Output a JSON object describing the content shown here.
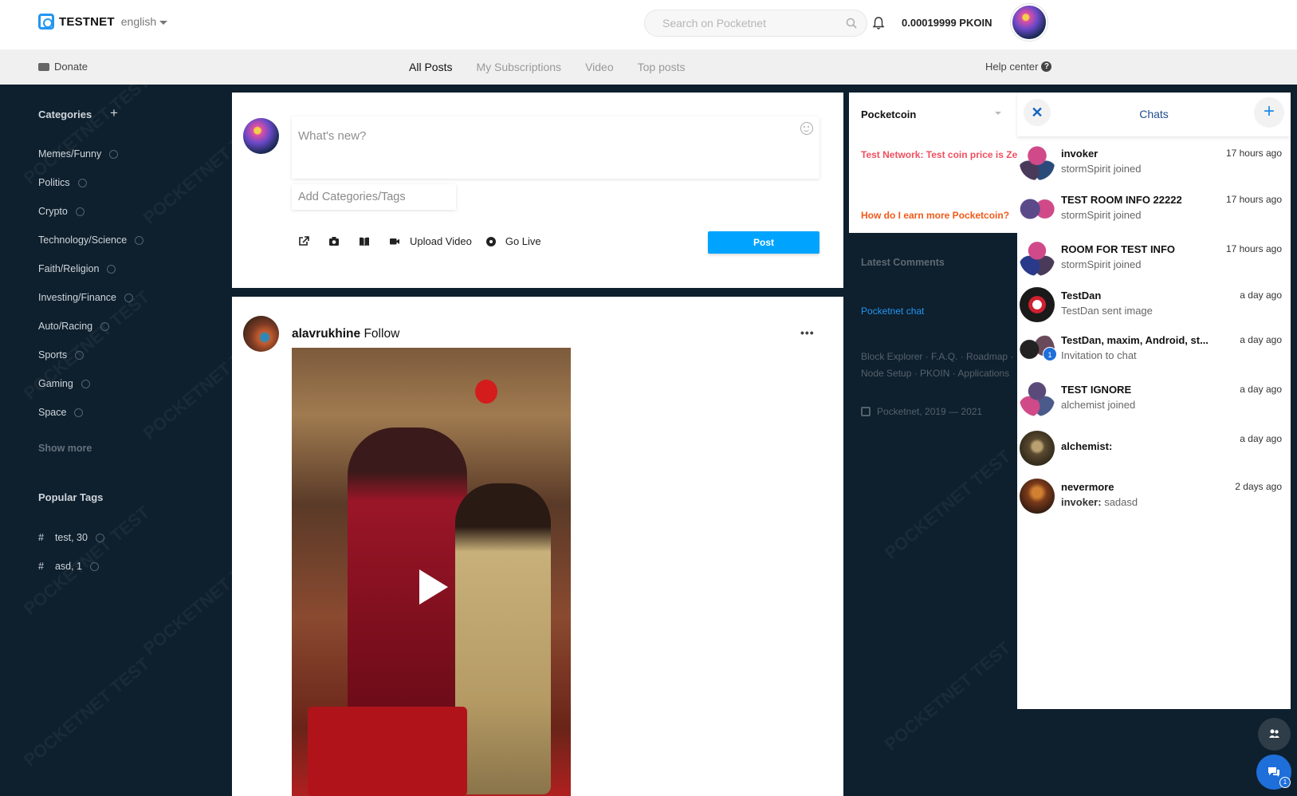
{
  "header": {
    "logo_text": "TESTNET",
    "language": "english",
    "search_placeholder": "Search on Pocketnet",
    "balance": "0.00019999 PKOIN"
  },
  "nav": {
    "donate": "Donate",
    "tabs": [
      {
        "label": "All Posts",
        "active": true
      },
      {
        "label": "My Subscriptions",
        "active": false
      },
      {
        "label": "Video",
        "active": false
      },
      {
        "label": "Top posts",
        "active": false
      }
    ],
    "help": "Help center",
    "help_icon": "?"
  },
  "sidebar": {
    "categories_title": "Categories",
    "add_symbol": "+",
    "categories": [
      "Memes/Funny",
      "Politics",
      "Crypto",
      "Technology/Science",
      "Faith/Religion",
      "Investing/Finance",
      "Auto/Racing",
      "Sports",
      "Gaming",
      "Space"
    ],
    "show_more": "Show more",
    "popular_tags_title": "Popular Tags",
    "tags": [
      {
        "hash": "#",
        "label": "test, 30"
      },
      {
        "hash": "#",
        "label": "asd, 1"
      }
    ]
  },
  "watermark": "POCKETNET TEST",
  "composer": {
    "placeholder": "What's new?",
    "tags_placeholder": "Add Categories/Tags",
    "upload_video": "Upload Video",
    "go_live": "Go Live",
    "post_button": "Post"
  },
  "post": {
    "author": "alavrukhine",
    "follow": "· Follow",
    "more": "•••"
  },
  "pocketcoin": {
    "title": "Pocketcoin",
    "news1": "Test Network: Test coin price is Ze",
    "news2": "How do I earn more Pocketcoin?"
  },
  "right": {
    "latest_comments": "Latest Comments",
    "pocketnet_chat": "Pocketnet chat",
    "links_line1": "Block Explorer · F.A.Q. · Roadmap ·",
    "links_line2": "Node Setup · PKOIN · Applications",
    "copyright": "Pocketnet, 2019 — 2021"
  },
  "chats": {
    "title": "Chats",
    "close_symbol": "✕",
    "add_symbol": "+",
    "items": [
      {
        "name": "invoker",
        "message": "stormSpirit joined",
        "time": "17 hours ago"
      },
      {
        "name": "TEST ROOM INFO 22222",
        "message": "stormSpirit joined",
        "time": "17 hours ago"
      },
      {
        "name": "ROOM FOR TEST INFO",
        "message": "stormSpirit joined",
        "time": "17 hours ago"
      },
      {
        "name": "TestDan",
        "message": "TestDan sent image",
        "time": "a day ago"
      },
      {
        "name": "TestDan, maxim, Android, st...",
        "message": "Invitation to chat",
        "time": "a day ago",
        "badge": "1"
      },
      {
        "name": "TEST IGNORE",
        "message": "alchemist joined",
        "time": "a day ago"
      },
      {
        "name": "",
        "message_bold": "alchemist:",
        "message": "",
        "time": "a day ago"
      },
      {
        "name": "nevermore",
        "message_bold": "invoker:",
        "message": "sadasd",
        "time": "2 days ago"
      }
    ],
    "fab_badge": "1"
  },
  "colors": {
    "accent": "#00a4ff",
    "dark_bg": "#0e1f2d",
    "news_red": "#ef4f5f",
    "news_orange": "#f05a1a",
    "link_blue": "#2196f3"
  }
}
